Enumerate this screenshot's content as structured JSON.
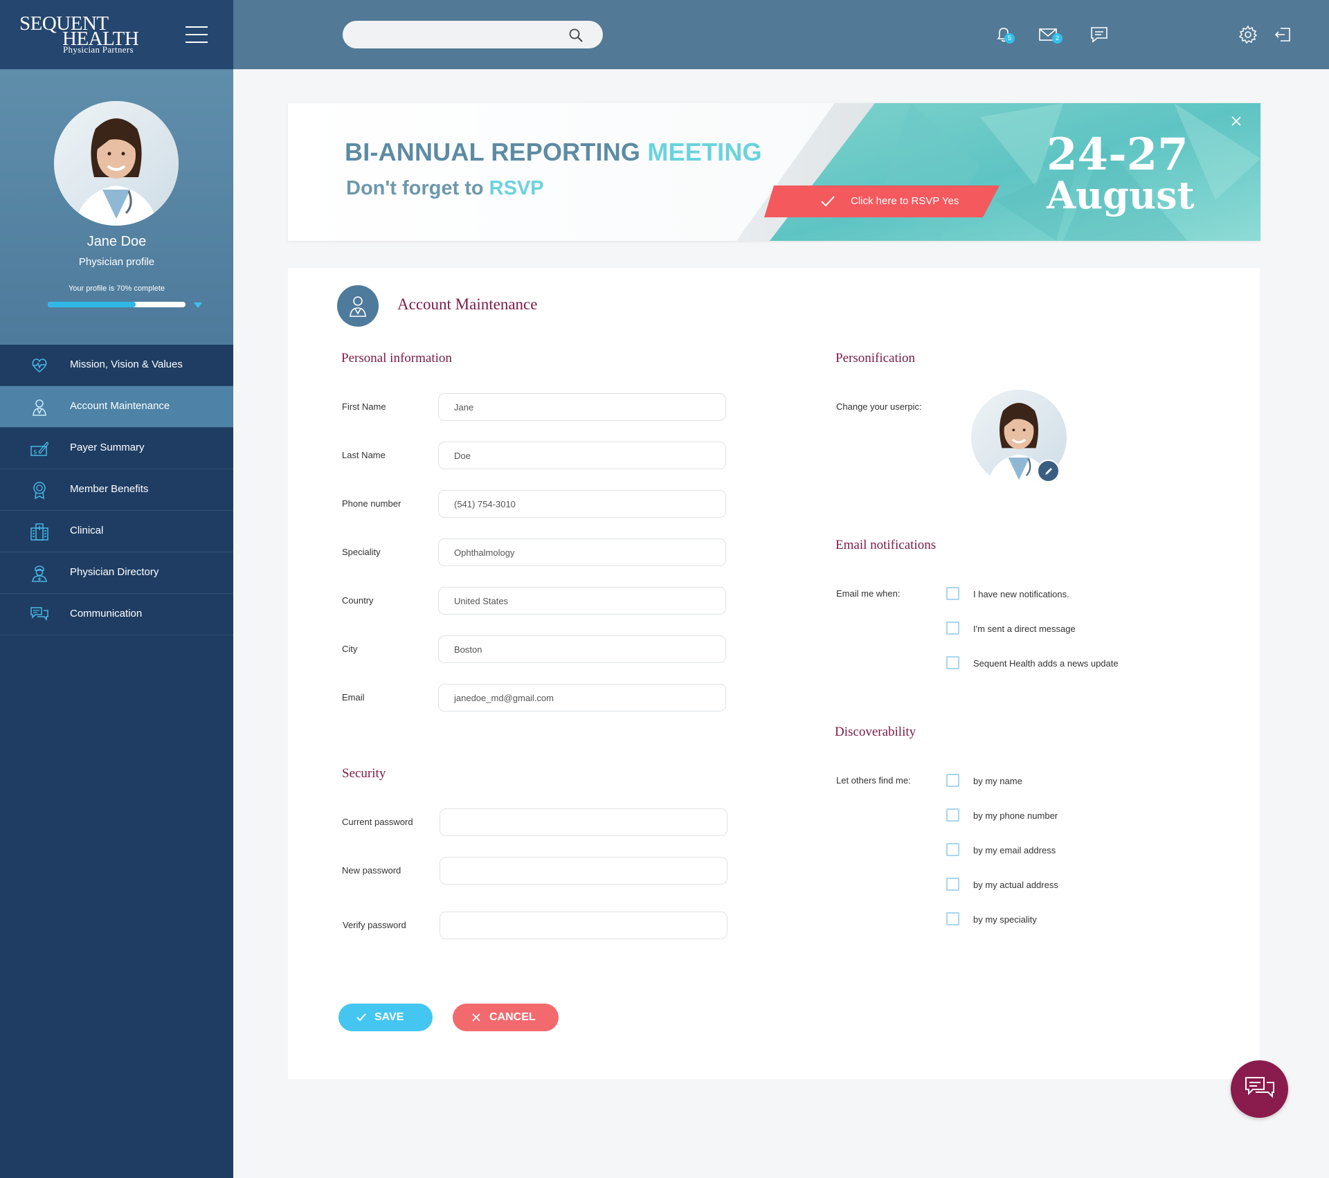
{
  "brand": {
    "line1": "SEQUENT",
    "line2": "HEALTH",
    "line3": "Physician Partners"
  },
  "profile": {
    "name": "Jane Doe",
    "role": "Physician profile",
    "completion_text": "Your profile is 70% complete",
    "completion_percent": 64
  },
  "nav": {
    "items": [
      {
        "label": "Mission, Vision & Values",
        "icon": "heart-pulse-icon"
      },
      {
        "label": "Account Maintenance",
        "icon": "doctor-icon"
      },
      {
        "label": "Payer Summary",
        "icon": "cheque-icon"
      },
      {
        "label": "Member Benefits",
        "icon": "award-icon"
      },
      {
        "label": "Clinical",
        "icon": "hospital-icon"
      },
      {
        "label": "Physician Directory",
        "icon": "nurse-icon"
      },
      {
        "label": "Communication",
        "icon": "chat-bubbles-icon"
      }
    ],
    "active_index": 1
  },
  "topbar": {
    "search_placeholder": "",
    "notifications_count": "5",
    "messages_count": "2"
  },
  "banner": {
    "title_a": "BI-ANNUAL REPORTING ",
    "title_b": "MEETING",
    "subtitle_a": "Don't forget to ",
    "subtitle_b": "RSVP",
    "rsvp_label": "Click here to RSVP Yes",
    "date_range": "24-27",
    "month": "August"
  },
  "page": {
    "title": "Account Maintenance"
  },
  "personal": {
    "title": "Personal information",
    "fields": [
      {
        "label": "First Name",
        "value": "Jane"
      },
      {
        "label": "Last Name",
        "value": "Doe"
      },
      {
        "label": "Phone number",
        "value": "(541) 754-3010"
      },
      {
        "label": "Speciality",
        "value": "Ophthalmology"
      },
      {
        "label": "Country",
        "value": "United States"
      },
      {
        "label": "City",
        "value": "Boston"
      },
      {
        "label": "Email",
        "value": "janedoe_md@gmail.com"
      }
    ]
  },
  "security": {
    "title": "Security",
    "fields": [
      {
        "label": "Current password",
        "value": ""
      },
      {
        "label": "New password",
        "value": ""
      },
      {
        "label": "Verify password",
        "value": ""
      }
    ]
  },
  "personification": {
    "title": "Personification",
    "label": "Change your userpic:"
  },
  "email_notifications": {
    "title": "Email notifications",
    "label": "Email me when:",
    "options": [
      "I have new notifications.",
      "I'm sent a direct message",
      "Sequent Health adds a news update"
    ]
  },
  "discoverability": {
    "title": "Discoverability",
    "label": "Let others find me:",
    "options": [
      "by my name",
      "by my phone number",
      "by my email address",
      "by my actual address",
      "by my speciality"
    ]
  },
  "actions": {
    "save": "SAVE",
    "cancel": "CANCEL"
  },
  "colors": {
    "sidebar": "#1f3d63",
    "topbar": "#527995",
    "accent": "#44c6f0",
    "danger": "#f26a6e",
    "heading": "#7c1a45"
  }
}
